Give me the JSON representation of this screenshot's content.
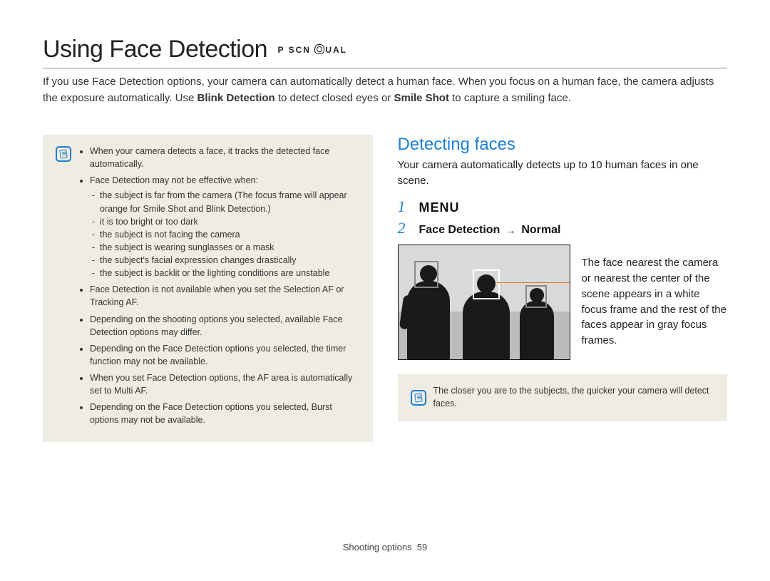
{
  "header": {
    "title": "Using Face Detection",
    "mode_p": "P",
    "mode_scn": "SCN",
    "mode_dual": "UAL"
  },
  "intro": {
    "part1": "If you use Face Detection options, your camera can automatically detect a human face. When you focus on a human face, the camera adjusts the exposure automatically. Use ",
    "bold1": "Blink Detection",
    "part2": " to detect closed eyes or ",
    "bold2": "Smile Shot",
    "part3": " to capture a smiling face."
  },
  "notes_left": {
    "items": [
      "When your camera detects a face, it tracks the detected face automatically.",
      "Face Detection may not be effective when:",
      "Face Detection is not available when you set the Selection AF or Tracking AF.",
      "Depending on the shooting options you selected, available Face Detection options may differ.",
      "Depending on the Face Detection options you selected, the timer function may not be available.",
      "When you set Face Detection options, the AF area is automatically set to Multi AF.",
      "Depending on the Face Detection options you selected, Burst options may not be available."
    ],
    "subitems": [
      "the subject is far from the camera (The focus frame will appear orange for Smile Shot and Blink Detection.)",
      "it is too bright or too dark",
      "the subject is not facing the camera",
      "the subject is wearing sunglasses or a mask",
      "the subject's facial expression changes drastically",
      "the subject is backlit or the lighting conditions are unstable"
    ]
  },
  "right": {
    "heading": "Detecting faces",
    "intro": "Your camera automatically detects up to 10 human faces in one scene.",
    "step1_num": "1",
    "step1_menu": "MENU",
    "step2_num": "2",
    "step2_label": "Face Detection",
    "step2_value": "Normal",
    "illus_caption": "The face nearest the camera or nearest the center of the scene appears in a white focus frame and the rest of the faces appear in gray focus frames.",
    "tip": "The closer you are to the subjects, the quicker your camera will detect faces."
  },
  "footer": {
    "section": "Shooting options",
    "page": "59"
  }
}
